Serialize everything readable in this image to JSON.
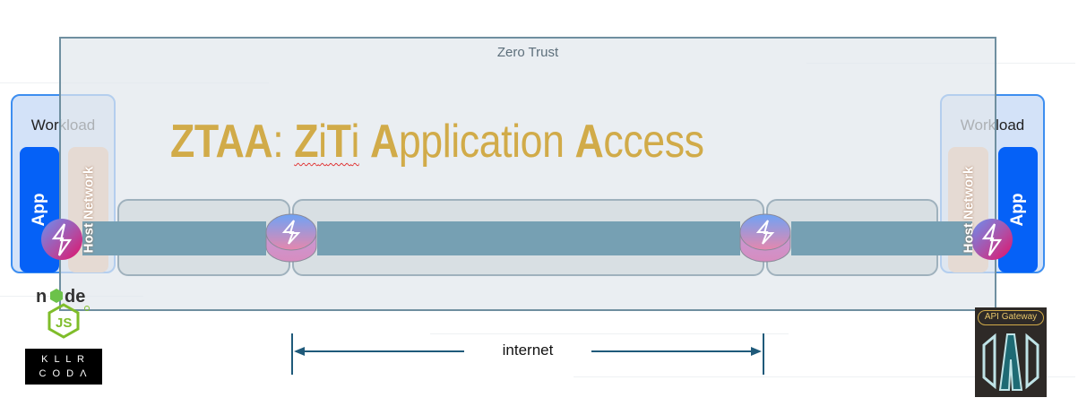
{
  "zero_trust": {
    "label": "Zero Trust"
  },
  "title": {
    "parts": [
      {
        "text": "ZTAA",
        "bold": true
      },
      {
        "text": ": ",
        "bold": false
      },
      {
        "text": "Z",
        "bold": true
      },
      {
        "text": "i",
        "bold": false
      },
      {
        "text": "T",
        "bold": true
      },
      {
        "text": "i",
        "bold": false
      },
      {
        "text": " ",
        "bold": false
      },
      {
        "text": "A",
        "bold": true
      },
      {
        "text": "pplication ",
        "bold": false
      },
      {
        "text": "A",
        "bold": true
      },
      {
        "text": "ccess",
        "bold": false
      }
    ]
  },
  "left_workload": {
    "label": "Workload",
    "app": "App",
    "network": "Host Network"
  },
  "right_workload": {
    "label": "Workload",
    "app": "App",
    "network": "Host Network"
  },
  "internet": {
    "label": "internet"
  },
  "logos": {
    "node": "node js",
    "killercoda_line1": "K L L R",
    "killercoda_line2": "C O D Λ",
    "api_gateway": "API Gateway"
  },
  "colors": {
    "title": "#d1ab49",
    "app": "#0561f7",
    "network": "#ecb890",
    "pipe": "#76a0b3",
    "workload_border": "#3d8ef0"
  }
}
